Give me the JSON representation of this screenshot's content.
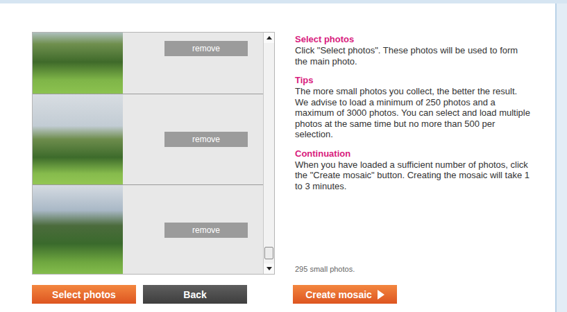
{
  "photo_list": {
    "items": [
      {
        "button": "remove"
      },
      {
        "button": "remove"
      },
      {
        "button": "remove"
      }
    ],
    "scrollbar": {
      "level": 0.98
    }
  },
  "sections": [
    {
      "heading": "Select photos",
      "text": "Click \"Select photos\". These photos will be used to form the main photo."
    },
    {
      "heading": "Tips",
      "text": "The more small photos you collect, the better the result. We advise to load a minimum of 250 photos and a maximum of 3000 photos. You can select and load multiple photos at the same time but no more than 500 per selection."
    },
    {
      "heading": "Continuation",
      "text": "When you have loaded a sufficient number of photos, click the \"Create mosaic\" button. Creating the mosaic will take 1 to 3 minutes."
    }
  ],
  "count": "295 small photos.",
  "buttons": [
    {
      "label": "Select photos",
      "kind": "primary"
    },
    {
      "label": "Back",
      "kind": "secondary"
    }
  ],
  "next_button": {
    "label": "Create mosaic",
    "kind": "primary"
  }
}
